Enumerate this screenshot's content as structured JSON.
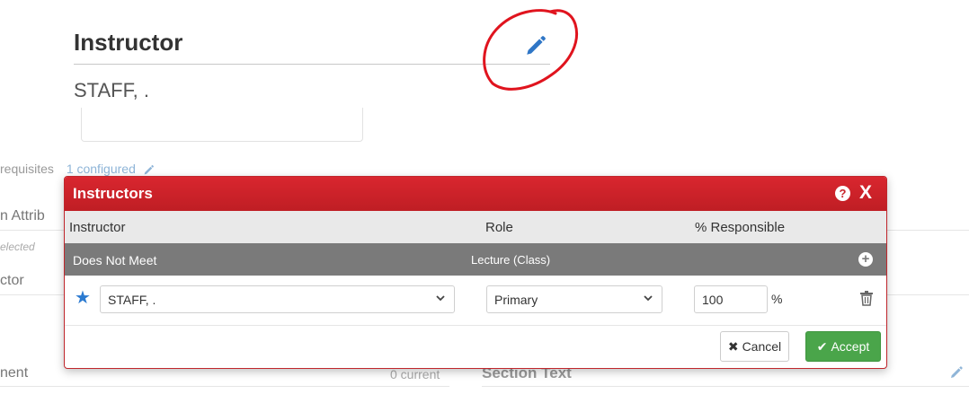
{
  "background": {
    "heading": "Instructor",
    "value": "STAFF, .",
    "prereq_label": "requisites",
    "prereq_link": "1 configured",
    "attrib_label": "n Attrib",
    "selected_label": "elected",
    "ctor_label": "ctor",
    "ment_label": "nent",
    "current_count": "0 current",
    "section_text": "Section Text"
  },
  "modal": {
    "title": "Instructors",
    "help_glyph": "?",
    "close_glyph": "X",
    "columns": {
      "instructor": "Instructor",
      "role": "Role",
      "percent": "% Responsible"
    },
    "group": {
      "name": "Does Not Meet",
      "role": "Lecture (Class)",
      "add_glyph": "+"
    },
    "row": {
      "instructor": "STAFF, .",
      "role": "Primary",
      "percent": "100",
      "percent_sign": "%"
    },
    "buttons": {
      "cancel_glyph": "✖",
      "cancel": "Cancel",
      "accept_glyph": "✔",
      "accept": "Accept"
    }
  },
  "colors": {
    "header_red": "#c8232a",
    "group_gray": "#7a7a7a",
    "accept_green": "#4aa54a",
    "star_blue": "#2b7ad0",
    "annotation_red": "#e0141e"
  },
  "icons": [
    "pencil-icon",
    "help-icon",
    "close-icon",
    "plus-icon",
    "star-icon",
    "chevron-down-icon",
    "trash-icon",
    "times-icon",
    "check-icon"
  ]
}
